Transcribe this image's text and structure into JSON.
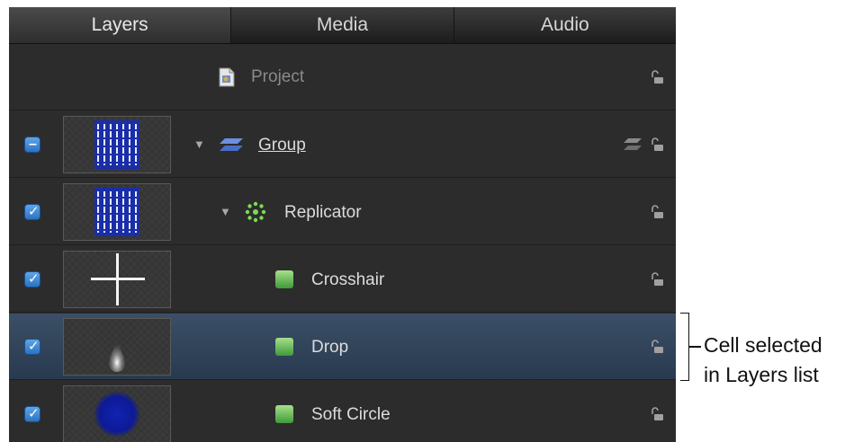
{
  "tabs": [
    {
      "label": "Layers",
      "active": true
    },
    {
      "label": "Media",
      "active": false
    },
    {
      "label": "Audio",
      "active": false
    }
  ],
  "layers": {
    "project": {
      "label": "Project",
      "icon": "project-document-icon"
    },
    "group": {
      "label": "Group",
      "icon": "group-layers-icon",
      "check": "mixed"
    },
    "replicator": {
      "label": "Replicator",
      "icon": "replicator-icon",
      "check": "checked"
    },
    "crosshair": {
      "label": "Crosshair",
      "icon": "cell-icon",
      "check": "checked"
    },
    "drop": {
      "label": "Drop",
      "icon": "cell-icon",
      "check": "checked",
      "selected": true
    },
    "soft_circle": {
      "label": "Soft Circle",
      "icon": "cell-icon",
      "check": "checked"
    }
  },
  "callout": {
    "line1": "Cell selected",
    "line2": "in Layers list"
  },
  "colors": {
    "panel_bg": "#2c2c2c",
    "selected_row": "#2f4257",
    "checkbox": "#3d8ad6",
    "cell_icon": "#5cb85c",
    "replicator_icon": "#7ed957",
    "group_icon": "#5c7fd6"
  }
}
